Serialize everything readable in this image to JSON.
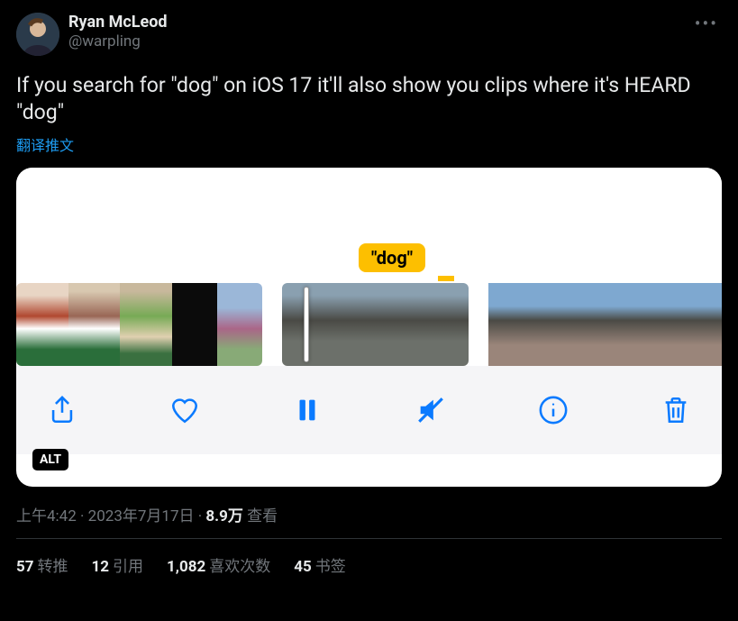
{
  "author": {
    "display_name": "Ryan McLeod",
    "handle": "@warpling"
  },
  "body_text": "If you search for \"dog\" on iOS 17 it'll also show you clips where it's HEARD \"dog\"",
  "translate_label": "翻译推文",
  "media": {
    "search_token": "\"dog\"",
    "alt_badge": "ALT",
    "toolbar_icons": [
      "share-icon",
      "heart-icon",
      "pause-icon",
      "mute-icon",
      "info-icon",
      "trash-icon"
    ]
  },
  "meta": {
    "time": "上午4:42",
    "date": "2023年7月17日",
    "views_count": "8.9万",
    "views_label": "查看",
    "separator": " · "
  },
  "stats": {
    "retweets": {
      "count": "57",
      "label": "转推"
    },
    "quotes": {
      "count": "12",
      "label": "引用"
    },
    "likes": {
      "count": "1,082",
      "label": "喜欢次数"
    },
    "bookmarks": {
      "count": "45",
      "label": "书签"
    }
  }
}
